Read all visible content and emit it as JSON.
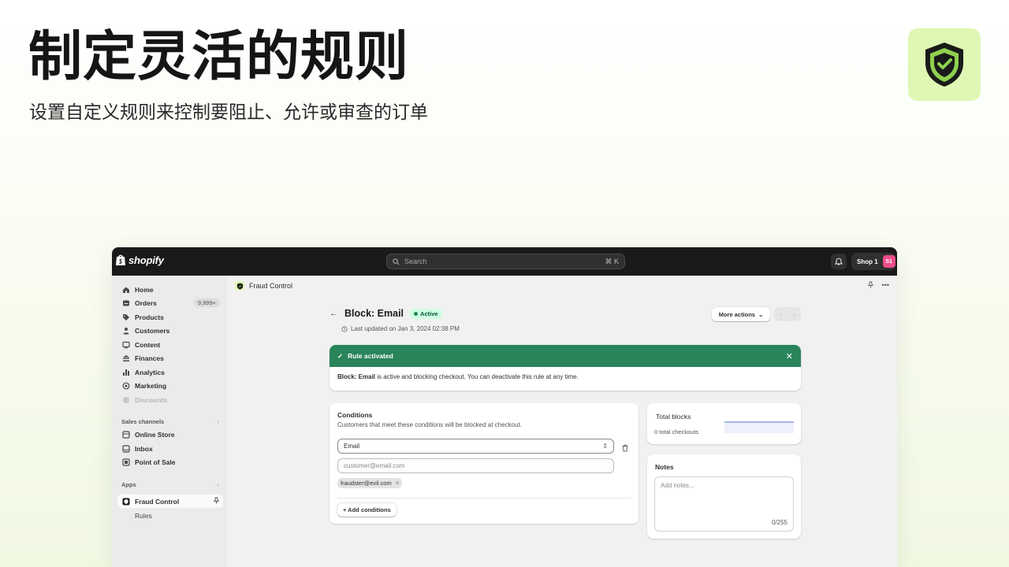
{
  "hero": {
    "title": "制定灵活的规则",
    "subtitle": "设置自定义规则来控制要阻止、允许或审查的订单"
  },
  "colors": {
    "brand_tile": "#dff7b4",
    "topbar": "#1a1a1a",
    "success": "#29845a",
    "badge_bg": "#cdfee1",
    "avatar": "#ec4d8a"
  },
  "topbar": {
    "logo_text": "shopify",
    "search_placeholder": "Search",
    "search_shortcut": "⌘ K",
    "shop_name": "Shop 1",
    "shop_initials": "S1"
  },
  "sidebar": {
    "items": [
      {
        "label": "Home",
        "icon": "home-icon"
      },
      {
        "label": "Orders",
        "icon": "orders-icon",
        "badge": "9,999+"
      },
      {
        "label": "Products",
        "icon": "tag-icon"
      },
      {
        "label": "Customers",
        "icon": "person-icon"
      },
      {
        "label": "Content",
        "icon": "content-icon"
      },
      {
        "label": "Finances",
        "icon": "bank-icon"
      },
      {
        "label": "Analytics",
        "icon": "bar-chart-icon"
      },
      {
        "label": "Marketing",
        "icon": "target-icon"
      },
      {
        "label": "Discounts",
        "icon": "discount-icon",
        "disabled": true
      }
    ],
    "sales_channels_label": "Sales channels",
    "sales_channels": [
      {
        "label": "Online Store",
        "icon": "store-icon"
      },
      {
        "label": "Inbox",
        "icon": "inbox-icon"
      },
      {
        "label": "Point of Sale",
        "icon": "pos-icon"
      }
    ],
    "apps_label": "Apps",
    "app": {
      "label": "Fraud Control",
      "icon": "shield-icon"
    },
    "app_sub": "Rules"
  },
  "main": {
    "breadcrumb": "Fraud Control",
    "page_title": "Block: Email",
    "status": "Active",
    "updated": "Last updated on Jan 3, 2024 02:38 PM",
    "more_actions": "More actions",
    "banner": {
      "title": "Rule activated",
      "body_bold": "Block: Email",
      "body_rest": " is active and blocking checkout. You can deactivate this rule at any time."
    },
    "conditions": {
      "title": "Conditions",
      "subtitle": "Customers that meet these conditions will be blocked at checkout.",
      "field": "Email",
      "input_placeholder": "customer@email.com",
      "tag": "fraudster@evil.com",
      "add_button": "+ Add conditions"
    },
    "blocks": {
      "title": "Total blocks",
      "subtitle": "0 total checkouts"
    },
    "notes": {
      "title": "Notes",
      "placeholder": "Add notes...",
      "counter": "0/255"
    }
  }
}
